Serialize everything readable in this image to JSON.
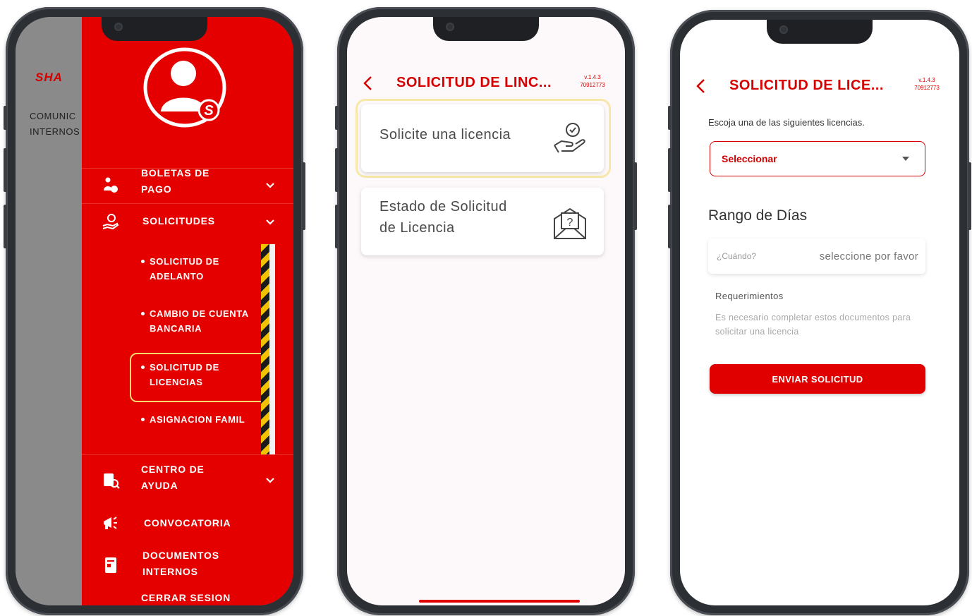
{
  "phone1": {
    "background_page": {
      "logo": "SHA",
      "text_line1": "COMUNIC",
      "text_line2": "INTERNOS"
    },
    "menu": {
      "items": [
        {
          "label_line1": "BOLETAS DE",
          "label_line2": "PAGO",
          "icon": "money-hand-icon",
          "expandable": true
        },
        {
          "label_line1": "SOLICITUDES",
          "label_line2": "",
          "icon": "hand-coin-icon",
          "expandable": true
        },
        {
          "label_line1": "CENTRO DE",
          "label_line2": "AYUDA",
          "icon": "help-document-icon",
          "expandable": true
        },
        {
          "label_line1": "CONVOCATORIA",
          "label_line2": "",
          "icon": "megaphone-icon",
          "expandable": false
        },
        {
          "label_line1": "DOCUMENTOS",
          "label_line2": "INTERNOS",
          "icon": "document-icon",
          "expandable": false
        },
        {
          "label_line1": "CERRAR SESION",
          "label_line2": "",
          "icon": "",
          "expandable": false
        }
      ],
      "subitems": [
        {
          "label_line1": "SOLICITUD DE",
          "label_line2": "ADELANTO"
        },
        {
          "label_line1": "CAMBIO DE CUENTA",
          "label_line2": "BANCARIA"
        },
        {
          "label_line1": "SOLICITUD DE",
          "label_line2": "LICENCIAS"
        },
        {
          "label_line1": "ASIGNACION FAMIL",
          "label_line2": ""
        }
      ]
    },
    "colors": {
      "drawer": "#e50000"
    }
  },
  "phone2": {
    "header": {
      "title": "SOLICITUD DE LINC...",
      "version": "v.1.4.3",
      "code": "70912773"
    },
    "cards": [
      {
        "line1": "Solicite una licencia",
        "line2": "",
        "icon": "hand-coin-icon"
      },
      {
        "line1": "Estado de Solicitud",
        "line2": "de Licencia",
        "icon": "question-envelope-icon"
      }
    ]
  },
  "phone3": {
    "header": {
      "title": "SOLICITUD DE LICE...",
      "version": "v.1.4.3",
      "code": "70912773"
    },
    "prompt": "Escoja una de las siguientes licencias.",
    "select": {
      "value": "Seleccionar"
    },
    "range_title": "Rango de Días",
    "date_field": {
      "label": "¿Cuándo?",
      "placeholder": "seleccione por favor"
    },
    "requirements": {
      "title": "Requerimientos",
      "text": "Es necesario completar estos documentos para solicitar una licencia"
    },
    "send_button": "ENVIAR SOLICITUD"
  }
}
